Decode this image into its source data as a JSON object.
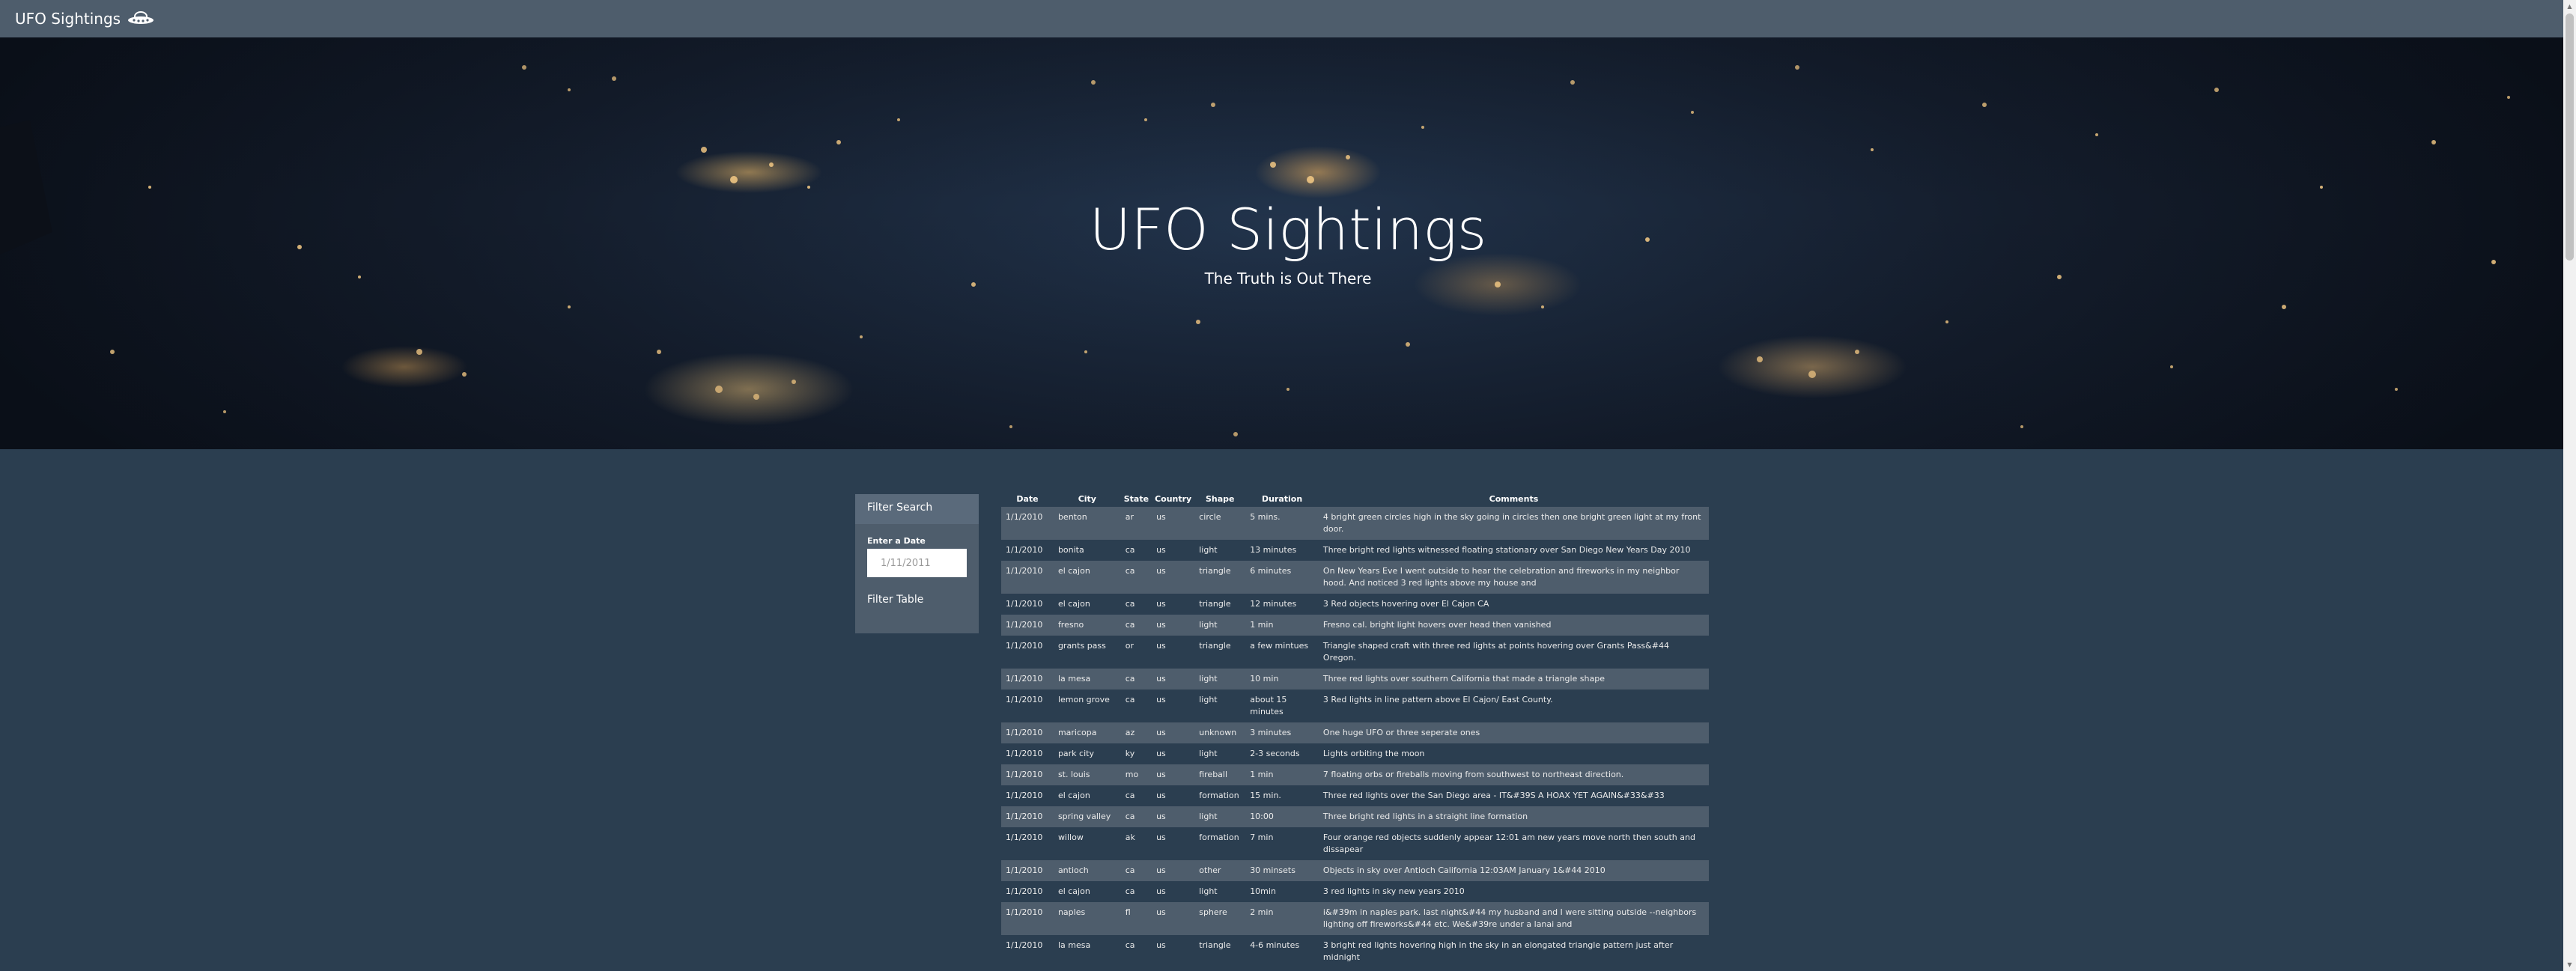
{
  "navbar": {
    "brand": "UFO Sightings",
    "brand_icon": "ufo-icon"
  },
  "hero": {
    "title": "UFO Sightings",
    "subtitle": "The Truth is Out There"
  },
  "filter": {
    "heading": "Filter Search",
    "date_label": "Enter a Date",
    "date_placeholder": "1/11/2011",
    "button": "Filter Table"
  },
  "table": {
    "headers": [
      "Date",
      "City",
      "State",
      "Country",
      "Shape",
      "Duration",
      "Comments"
    ],
    "rows": [
      [
        "1/1/2010",
        "benton",
        "ar",
        "us",
        "circle",
        "5 mins.",
        "4 bright green circles high in the sky going in circles then one bright green light at my front door."
      ],
      [
        "1/1/2010",
        "bonita",
        "ca",
        "us",
        "light",
        "13 minutes",
        "Three bright red lights witnessed floating stationary over San Diego New Years Day 2010"
      ],
      [
        "1/1/2010",
        "el cajon",
        "ca",
        "us",
        "triangle",
        "6 minutes",
        "On New Years Eve I went outside to hear the celebration and fireworks in my neighbor hood. And noticed 3 red lights above my house and"
      ],
      [
        "1/1/2010",
        "el cajon",
        "ca",
        "us",
        "triangle",
        "12 minutes",
        "3 Red objects hovering over El Cajon CA"
      ],
      [
        "1/1/2010",
        "fresno",
        "ca",
        "us",
        "light",
        "1 min",
        "Fresno cal. bright light hovers over head then vanished"
      ],
      [
        "1/1/2010",
        "grants pass",
        "or",
        "us",
        "triangle",
        "a few mintues",
        "Triangle shaped craft with three red lights at points hovering over Grants Pass&#44 Oregon."
      ],
      [
        "1/1/2010",
        "la mesa",
        "ca",
        "us",
        "light",
        "10 min",
        "Three red lights over southern California that made a triangle shape"
      ],
      [
        "1/1/2010",
        "lemon grove",
        "ca",
        "us",
        "light",
        "about 15 minutes",
        "3 Red lights in line pattern above El Cajon/ East County."
      ],
      [
        "1/1/2010",
        "maricopa",
        "az",
        "us",
        "unknown",
        "3 minutes",
        "One huge UFO or three seperate ones"
      ],
      [
        "1/1/2010",
        "park city",
        "ky",
        "us",
        "light",
        "2-3 seconds",
        "Lights orbiting the moon"
      ],
      [
        "1/1/2010",
        "st. louis",
        "mo",
        "us",
        "fireball",
        "1 min",
        "7 floating orbs or fireballs moving from southwest to northeast direction."
      ],
      [
        "1/1/2010",
        "el cajon",
        "ca",
        "us",
        "formation",
        "15 min.",
        "Three red lights over the San Diego area - IT&#39S A HOAX YET AGAIN&#33&#33"
      ],
      [
        "1/1/2010",
        "spring valley",
        "ca",
        "us",
        "light",
        "10:00",
        "Three bright red lights in a straight line formation"
      ],
      [
        "1/1/2010",
        "willow",
        "ak",
        "us",
        "formation",
        "7 min",
        "Four orange red objects suddenly appear 12:01 am new years move north then south and dissapear"
      ],
      [
        "1/1/2010",
        "antioch",
        "ca",
        "us",
        "other",
        "30 minsets",
        "Objects in sky over Antioch California 12:03AM January 1&#44 2010"
      ],
      [
        "1/1/2010",
        "el cajon",
        "ca",
        "us",
        "light",
        "10min",
        "3 red lights in sky new years 2010"
      ],
      [
        "1/1/2010",
        "naples",
        "fl",
        "us",
        "sphere",
        "2 min",
        "i&#39m in naples park. last night&#44 my husband and I were sitting outside --neighbors lighting off fireworks&#44 etc. We&#39re under a lanai and"
      ],
      [
        "1/1/2010",
        "la mesa",
        "ca",
        "us",
        "triangle",
        "4-6 minutes",
        "3 bright red lights hovering high in the sky in an elongated triangle pattern just after midnight"
      ]
    ]
  },
  "colors": {
    "page_bg": "#2b3e50",
    "navbar_bg": "#4e5d6c",
    "row_odd": "#4e5d6c",
    "row_even": "#2b3e50"
  }
}
